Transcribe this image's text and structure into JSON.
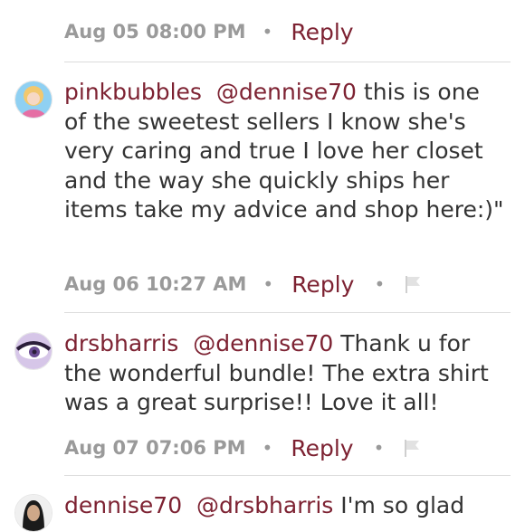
{
  "comments": [
    {
      "time": "Aug 05 08:00 PM",
      "reply_label": "Reply"
    },
    {
      "username": "pinkbubbles",
      "mention": "@dennise70",
      "text": "this is one of the sweetest sellers I know she's very caring and true I love her closet and the way she quickly ships her items  take my advice and shop here:)\"",
      "time": "Aug 06 10:27 AM",
      "reply_label": "Reply",
      "flag_icon": "flag-icon",
      "avatar_colors": [
        "#f2c86e",
        "#e56fa4",
        "#8fd0f2"
      ]
    },
    {
      "username": "drsbharris",
      "mention": "@dennise70",
      "text": "Thank u for the wonderful bundle! The extra shirt was a great surprise!! Love it all!",
      "time": "Aug 07 07:06 PM",
      "reply_label": "Reply",
      "flag_icon": "flag-icon",
      "avatar_colors": [
        "#6a4c93",
        "#2b1e3a",
        "#d6c6e8"
      ]
    },
    {
      "username": "dennise70",
      "mention": "@drsbharris",
      "text": "I'm so glad",
      "avatar_colors": [
        "#1b1b1b",
        "#cfa889",
        "#f0f0f0"
      ]
    }
  ],
  "colors": {
    "accent": "#7d2232",
    "meta_gray": "#9a9a9a",
    "divider": "#dcdcdc"
  }
}
